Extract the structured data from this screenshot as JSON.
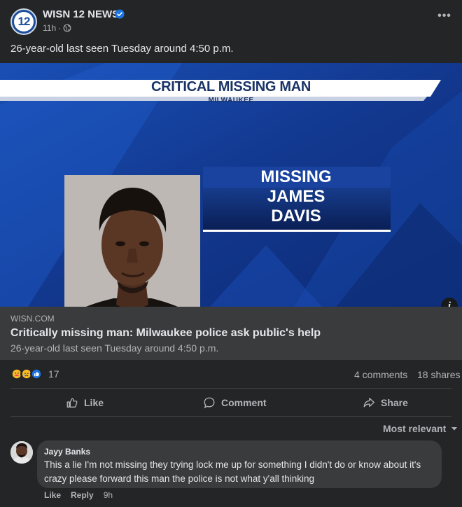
{
  "post": {
    "page_name": "WISN 12 NEWS",
    "time": "11h",
    "separator": "·",
    "avatar_text": "12",
    "text": "26-year-old last seen Tuesday around 4:50 p.m.",
    "more_icon": "more-horizontal-icon",
    "verified_icon": "verified-badge-icon",
    "audience_icon": "globe-icon"
  },
  "image": {
    "banner_title": "CRITICAL MISSING MAN",
    "banner_subtitle": "MILWAUKEE",
    "name_lines": [
      "MISSING",
      "JAMES",
      "DAVIS"
    ],
    "colors": {
      "background": "#12388f",
      "accent": "#1e4fd0"
    }
  },
  "link": {
    "domain": "WISN.COM",
    "title": "Critically missing man: Milwaukee police ask public's help",
    "description": "26-year-old last seen Tuesday around 4:50 p.m."
  },
  "stats": {
    "reaction_count": "17",
    "reaction_icons": [
      "care-reaction-icon",
      "sad-reaction-icon",
      "like-reaction-icon"
    ],
    "comments": "4 comments",
    "shares": "18 shares"
  },
  "actions": {
    "like": "Like",
    "comment": "Comment",
    "share": "Share"
  },
  "comments_section": {
    "sort_label": "Most relevant",
    "items": [
      {
        "author": "Jayy Banks",
        "text": "This a lie I'm not missing they trying lock me up for something I didn't do or know about it's crazy please forward this man the police is not what y'all thinking",
        "like": "Like",
        "reply": "Reply",
        "time": "9h"
      }
    ]
  }
}
